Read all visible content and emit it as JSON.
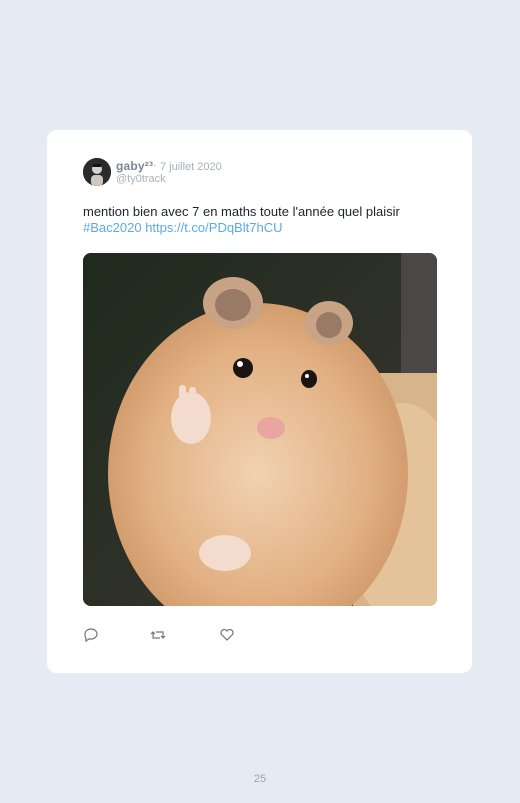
{
  "tweet": {
    "display_name": "gaby²³",
    "separator": "·",
    "date": "7 juillet 2020",
    "handle": "@ty0track",
    "text": "mention bien avec 7 en maths toute l'année quel plaisir",
    "hashtag": "#Bac2020",
    "link": "https://t.co/PDqBlt7hCU",
    "media_description": "hamster photo",
    "actions": [
      "reply-icon",
      "retweet-icon",
      "like-icon"
    ]
  },
  "page": {
    "number": "25"
  },
  "colors": {
    "background": "#e6ebf3",
    "card": "#ffffff",
    "link": "#5aa9e6",
    "muted": "#a8b1bc"
  }
}
